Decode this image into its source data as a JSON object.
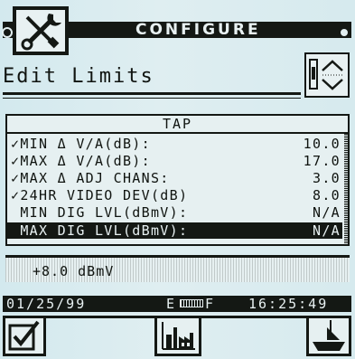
{
  "header": {
    "title": "CONFIGURE",
    "icon": "wrench-screwdriver-icon"
  },
  "screen": {
    "title": "Edit Limits",
    "scroll_icon": "up-down-scroll-icon"
  },
  "table": {
    "heading": "TAP",
    "rows": [
      {
        "label": "✓MIN Δ V/A(dB):",
        "value": "10.0"
      },
      {
        "label": "✓MAX Δ V/A(dB):",
        "value": "17.0"
      },
      {
        "label": "✓MAX Δ ADJ CHANS:",
        "value": "3.0"
      },
      {
        "label": "✓24HR VIDEO DEV(dB)",
        "value": "8.0"
      },
      {
        "label": " MIN DIG LVL(dBmV):",
        "value": "N/A"
      },
      {
        "label": " MAX DIG LVL(dBmV):",
        "value": "N/A"
      }
    ],
    "selected_index": 5
  },
  "edit_value": "+8.0 dBmV",
  "status": {
    "date": "01/25/99",
    "battery_empty": "E",
    "battery_full": "F",
    "time": "16:25:49"
  },
  "softkeys": [
    {
      "icon": "checkbox-icon"
    },
    {
      "icon": "factory-chart-icon"
    },
    {
      "icon": "boat-icon"
    }
  ],
  "colors": {
    "lcd_background": "#e6f0f1",
    "lcd_ink": "#141814"
  }
}
